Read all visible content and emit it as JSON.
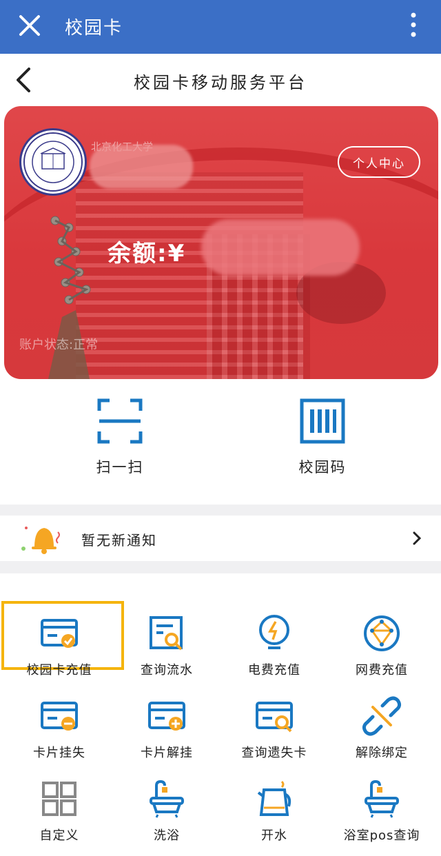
{
  "appbar": {
    "title": "校园卡"
  },
  "subheader": {
    "title": "校园卡移动服务平台"
  },
  "card": {
    "school_name": "北京化工大学",
    "balance_label": "余额:¥",
    "status": "账户状态:正常",
    "personal_center": "个人中心"
  },
  "quick": [
    {
      "label": "扫一扫",
      "icon": "scan-icon"
    },
    {
      "label": "校园码",
      "icon": "barcode-icon"
    }
  ],
  "notice": {
    "text": "暂无新通知"
  },
  "grid": [
    {
      "label": "校园卡充值",
      "icon": "card-check-icon"
    },
    {
      "label": "查询流水",
      "icon": "document-search-icon"
    },
    {
      "label": "电费充值",
      "icon": "bulb-icon"
    },
    {
      "label": "网费充值",
      "icon": "network-icon"
    },
    {
      "label": "卡片挂失",
      "icon": "card-minus-icon"
    },
    {
      "label": "卡片解挂",
      "icon": "card-plus-icon"
    },
    {
      "label": "查询遗失卡",
      "icon": "card-search-icon"
    },
    {
      "label": "解除绑定",
      "icon": "unlink-icon"
    },
    {
      "label": "自定义",
      "icon": "grid-icon"
    },
    {
      "label": "洗浴",
      "icon": "bathtub-icon"
    },
    {
      "label": "开水",
      "icon": "kettle-icon"
    },
    {
      "label": "浴室pos查询",
      "icon": "bathtub-search-icon"
    }
  ],
  "colors": {
    "primary": "#3b6fc6",
    "accent_blue": "#1a78c2",
    "accent_orange": "#f5a623",
    "card_red": "#d9383c",
    "highlight": "#f5b40b"
  }
}
